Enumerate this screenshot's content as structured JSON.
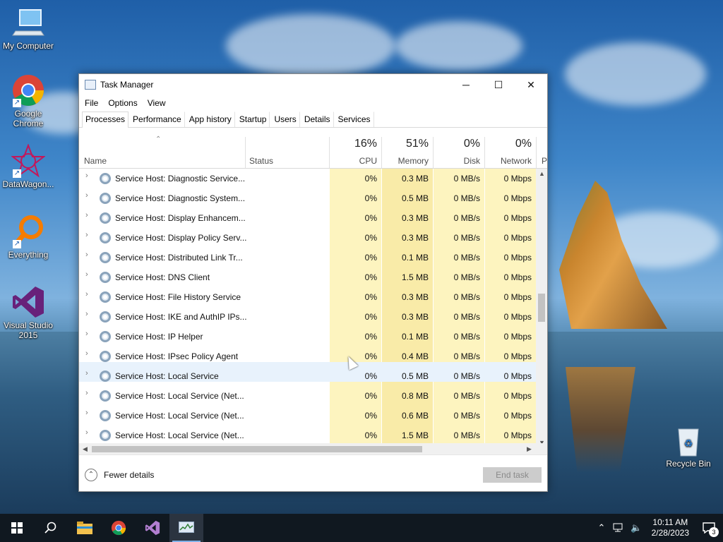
{
  "desktop": {
    "icons": [
      {
        "label": "My Computer",
        "icon": "computer-icon"
      },
      {
        "label": "Google Chrome",
        "icon": "chrome-icon"
      },
      {
        "label": "DataWagon...",
        "icon": "datawagon-icon"
      },
      {
        "label": "Everything",
        "icon": "everything-search-icon"
      },
      {
        "label": "Visual Studio 2015",
        "icon": "visual-studio-icon"
      },
      {
        "label": "Recycle Bin",
        "icon": "recycle-bin-icon"
      }
    ]
  },
  "window": {
    "title": "Task Manager",
    "controls": {
      "minimize": "─",
      "maximize": "☐",
      "close": "✕"
    },
    "menu": [
      "File",
      "Options",
      "View"
    ],
    "tabs": [
      "Processes",
      "Performance",
      "App history",
      "Startup",
      "Users",
      "Details",
      "Services"
    ],
    "active_tab": "Processes",
    "columns": {
      "name": "Name",
      "status": "Status",
      "cpu": {
        "pct": "16%",
        "label": "CPU"
      },
      "memory": {
        "pct": "51%",
        "label": "Memory"
      },
      "disk": {
        "pct": "0%",
        "label": "Disk"
      },
      "network": {
        "pct": "0%",
        "label": "Network"
      },
      "power": "P"
    },
    "rows": [
      {
        "name": "Service Host: Diagnostic Service...",
        "cpu": "0%",
        "memory": "0.3 MB",
        "disk": "0 MB/s",
        "network": "0 Mbps"
      },
      {
        "name": "Service Host: Diagnostic System...",
        "cpu": "0%",
        "memory": "0.5 MB",
        "disk": "0 MB/s",
        "network": "0 Mbps"
      },
      {
        "name": "Service Host: Display Enhancem...",
        "cpu": "0%",
        "memory": "0.3 MB",
        "disk": "0 MB/s",
        "network": "0 Mbps"
      },
      {
        "name": "Service Host: Display Policy Serv...",
        "cpu": "0%",
        "memory": "0.3 MB",
        "disk": "0 MB/s",
        "network": "0 Mbps"
      },
      {
        "name": "Service Host: Distributed Link Tr...",
        "cpu": "0%",
        "memory": "0.1 MB",
        "disk": "0 MB/s",
        "network": "0 Mbps"
      },
      {
        "name": "Service Host: DNS Client",
        "cpu": "0%",
        "memory": "1.5 MB",
        "disk": "0 MB/s",
        "network": "0 Mbps"
      },
      {
        "name": "Service Host: File History Service",
        "cpu": "0%",
        "memory": "0.3 MB",
        "disk": "0 MB/s",
        "network": "0 Mbps"
      },
      {
        "name": "Service Host: IKE and AuthIP IPs...",
        "cpu": "0%",
        "memory": "0.3 MB",
        "disk": "0 MB/s",
        "network": "0 Mbps"
      },
      {
        "name": "Service Host: IP Helper",
        "cpu": "0%",
        "memory": "0.1 MB",
        "disk": "0 MB/s",
        "network": "0 Mbps"
      },
      {
        "name": "Service Host: IPsec Policy Agent",
        "cpu": "0%",
        "memory": "0.4 MB",
        "disk": "0 MB/s",
        "network": "0 Mbps"
      },
      {
        "name": "Service Host: Local Service",
        "cpu": "0%",
        "memory": "0.5 MB",
        "disk": "0 MB/s",
        "network": "0 Mbps"
      },
      {
        "name": "Service Host: Local Service (Net...",
        "cpu": "0%",
        "memory": "0.8 MB",
        "disk": "0 MB/s",
        "network": "0 Mbps"
      },
      {
        "name": "Service Host: Local Service (Net...",
        "cpu": "0%",
        "memory": "0.6 MB",
        "disk": "0 MB/s",
        "network": "0 Mbps"
      },
      {
        "name": "Service Host: Local Service (Net...",
        "cpu": "0%",
        "memory": "1.5 MB",
        "disk": "0 MB/s",
        "network": "0 Mbps"
      }
    ],
    "hovered_row": 10,
    "footer": {
      "fewer_details": "Fewer details",
      "end_task": "End task"
    }
  },
  "taskbar": {
    "apps": [
      "start-icon",
      "search-icon",
      "file-explorer-icon",
      "chrome-icon",
      "visual-studio-icon",
      "task-manager-icon"
    ],
    "active_app": "task-manager-icon",
    "time": "10:11 AM",
    "date": "2/28/2023",
    "notifications": "3"
  },
  "colors": {
    "cpu_col": "#fdf4bf",
    "mem_col": "#f9eba8",
    "disk_col": "#fdf4bf",
    "net_col": "#fdf4bf",
    "taskbar": "#101820",
    "hover": "#e8f2fc"
  }
}
